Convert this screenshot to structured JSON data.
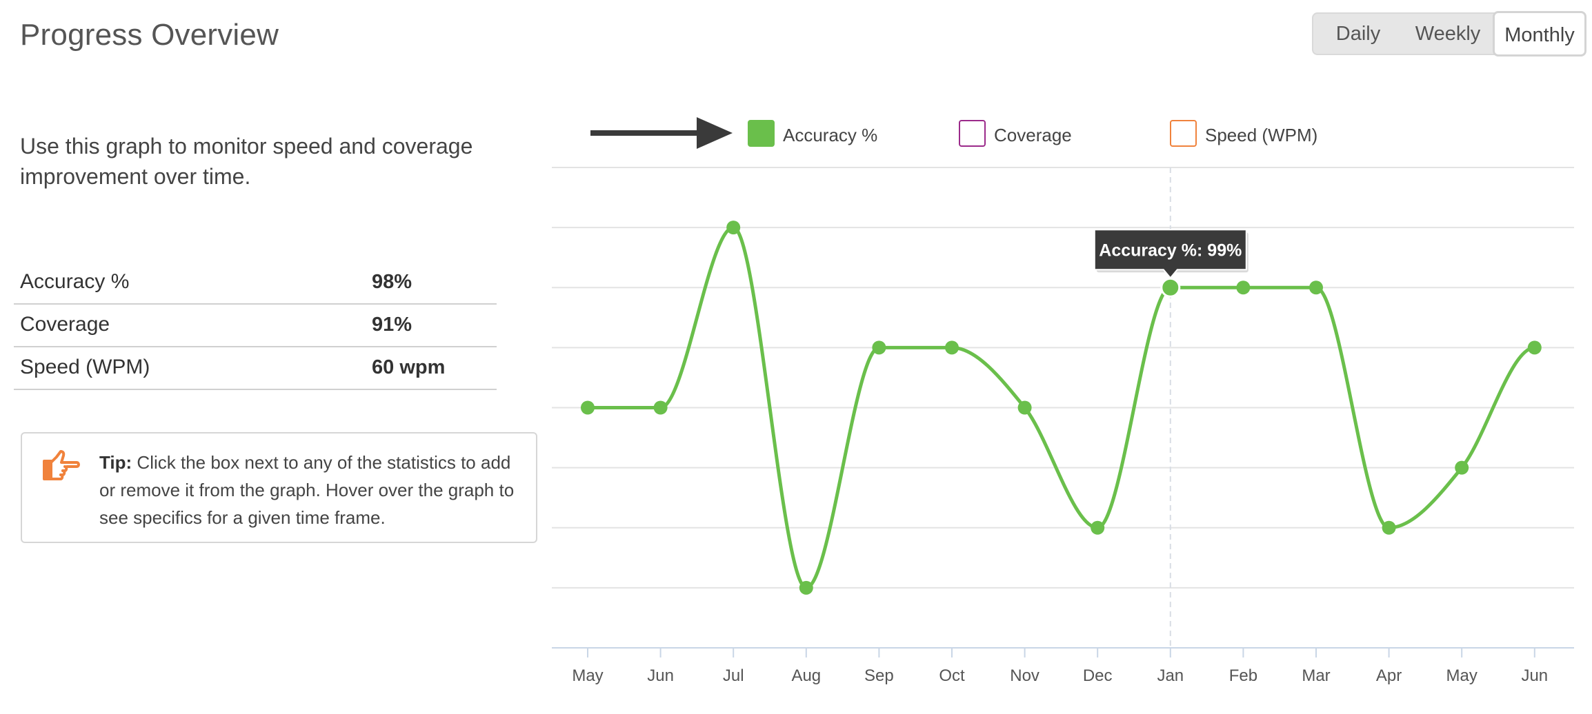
{
  "header": {
    "title": "Progress Overview",
    "periods": [
      "Daily",
      "Weekly",
      "Monthly"
    ],
    "selected_period": "Monthly"
  },
  "intro": {
    "text": "Use this graph to monitor speed and coverage improvement over time."
  },
  "stats": [
    {
      "label": "Accuracy %",
      "value": "98%"
    },
    {
      "label": "Coverage",
      "value": "91%"
    },
    {
      "label": "Speed (WPM)",
      "value": "60 wpm"
    }
  ],
  "tip": {
    "label": "Tip:",
    "text": "Click the box next to any of the statistics to add or remove it from the graph. Hover over the graph to see specifics for a given time frame.",
    "icon": "pointing-hand-icon"
  },
  "colors": {
    "accuracy": "#6abf4b",
    "coverage": "#9b2a8a",
    "speed": "#f0823c",
    "tooltip_bg": "#3a3a3a",
    "arrow": "#3a3a3a"
  },
  "chart_data": {
    "type": "line",
    "categories": [
      "May",
      "Jun",
      "Jul",
      "Aug",
      "Sep",
      "Oct",
      "Nov",
      "Dec",
      "Jan",
      "Feb",
      "Mar",
      "Apr",
      "May",
      "Jun"
    ],
    "legend": [
      {
        "name": "Accuracy %",
        "checked": true,
        "color": "#6abf4b"
      },
      {
        "name": "Coverage",
        "checked": false,
        "color": "#9b2a8a"
      },
      {
        "name": "Speed (WPM)",
        "checked": false,
        "color": "#f0823c"
      }
    ],
    "series": [
      {
        "name": "Accuracy %",
        "values": [
          96,
          96,
          99,
          93,
          97,
          97,
          96,
          94,
          98,
          98,
          98,
          94,
          95,
          97
        ]
      }
    ],
    "ylim": [
      92,
      100
    ],
    "grid": true,
    "y_tick_labels_shown": false,
    "tooltip": {
      "category_index": 8,
      "text": "Accuracy %: 99%"
    }
  }
}
